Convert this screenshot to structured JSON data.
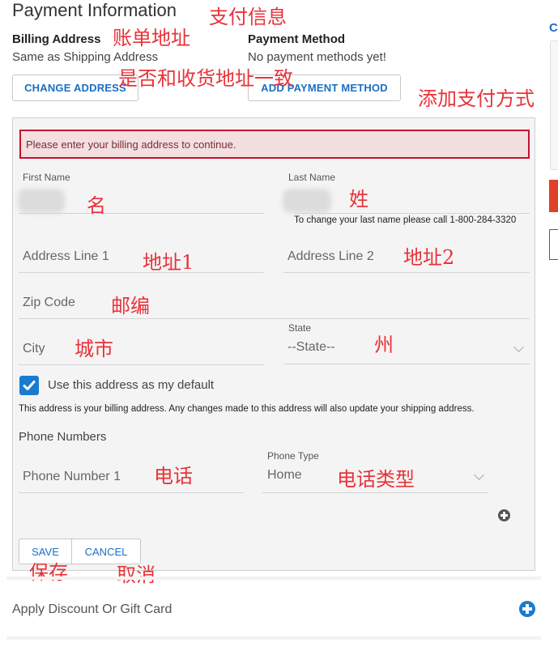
{
  "page": {
    "title": "Payment Information"
  },
  "billing": {
    "heading": "Billing Address",
    "status": "Same as Shipping Address",
    "change_button": "CHANGE ADDRESS"
  },
  "payment": {
    "heading": "Payment Method",
    "status": "No payment methods yet!",
    "add_button": "ADD PAYMENT METHOD"
  },
  "form": {
    "error_message": "Please enter your billing address to continue.",
    "first_name": {
      "label": "First Name",
      "value": ""
    },
    "last_name": {
      "label": "Last Name",
      "value": "",
      "note": "To change your last name please call 1-800-284-3320"
    },
    "address_line_1": {
      "placeholder": "Address Line 1"
    },
    "address_line_2": {
      "placeholder": "Address Line 2"
    },
    "zip_code": {
      "placeholder": "Zip Code"
    },
    "city": {
      "placeholder": "City"
    },
    "state": {
      "label": "State",
      "selected": "--State--"
    },
    "default_checkbox": {
      "label": "Use this address as my default",
      "checked": true
    },
    "billing_note": "This address is your billing address. Any changes made to this address will also update your shipping address.",
    "phone_section_title": "Phone Numbers",
    "phone_number_1": {
      "placeholder": "Phone Number 1"
    },
    "phone_type": {
      "label": "Phone Type",
      "selected": "Home"
    },
    "save_button": "SAVE",
    "cancel_button": "CANCEL"
  },
  "discount": {
    "label": "Apply Discount Or Gift Card"
  },
  "sidebar_partial": {
    "heading_fragment": "C"
  },
  "annotations": {
    "payment_info": "支付信息",
    "billing_address": "账单地址",
    "same_as_shipping": "是否和收货地址一致",
    "add_payment": "添加支付方式",
    "first_name": "名",
    "last_name": "姓",
    "address1": "地址1",
    "address2": "地址2",
    "zip": "邮编",
    "city": "城市",
    "state": "州",
    "phone": "电话",
    "phone_type": "电话类型",
    "save": "保存",
    "cancel": "取消"
  },
  "colors": {
    "accent_blue": "#1a6fc4",
    "error_border": "#c8102e",
    "error_bg": "#f3dfe0",
    "annotation_red": "#e8323a",
    "checkbox_blue": "#1a7bd0",
    "sidebar_red": "#e0402a"
  }
}
